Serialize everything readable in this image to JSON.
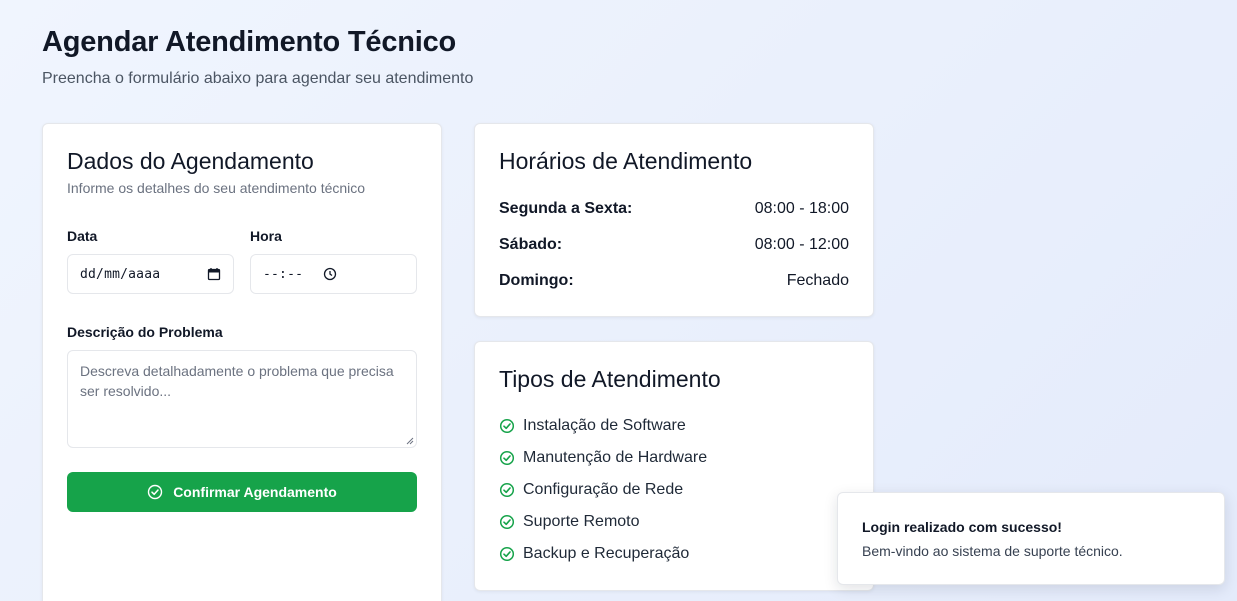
{
  "header": {
    "title": "Agendar Atendimento Técnico",
    "subtitle": "Preencha o formulário abaixo para agendar seu atendimento"
  },
  "form": {
    "title": "Dados do Agendamento",
    "subtitle": "Informe os detalhes do seu atendimento técnico",
    "date_label": "Data",
    "date_placeholder": "dd/mm/aaaa",
    "time_label": "Hora",
    "time_placeholder": "--:--",
    "description_label": "Descrição do Problema",
    "description_placeholder": "Descreva detalhadamente o problema que precisa ser resolvido...",
    "submit_label": "Confirmar Agendamento",
    "accent_color": "#16a34a"
  },
  "hours": {
    "title": "Horários de Atendimento",
    "rows": [
      {
        "day": "Segunda a Sexta:",
        "time": "08:00 - 18:00"
      },
      {
        "day": "Sábado:",
        "time": "08:00 - 12:00"
      },
      {
        "day": "Domingo:",
        "time": "Fechado"
      }
    ]
  },
  "types": {
    "title": "Tipos de Atendimento",
    "icon": "check-circle-icon",
    "items": [
      "Instalação de Software",
      "Manutenção de Hardware",
      "Configuração de Rede",
      "Suporte Remoto",
      "Backup e Recuperação"
    ]
  },
  "toast": {
    "title": "Login realizado com sucesso!",
    "message": "Bem-vindo ao sistema de suporte técnico."
  }
}
